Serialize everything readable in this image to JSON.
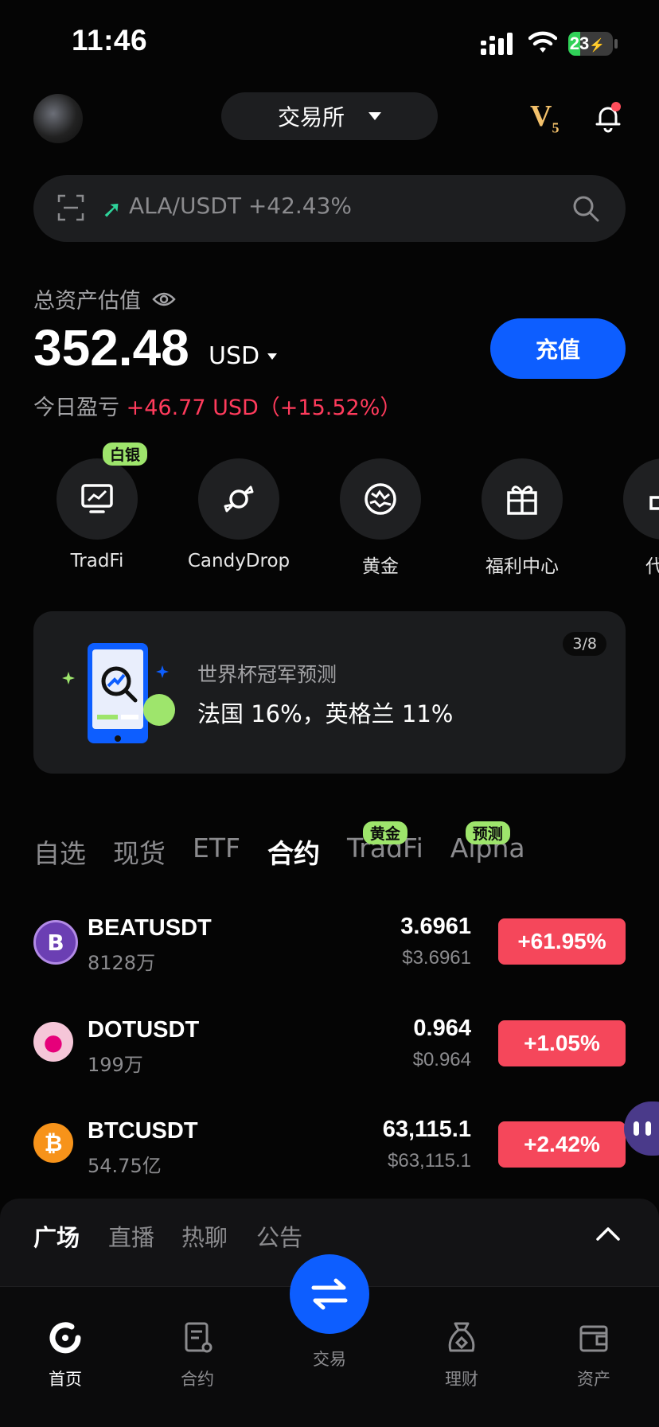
{
  "status_bar": {
    "time": "11:46",
    "battery": "23"
  },
  "header": {
    "exchange_label": "交易所",
    "vip_level": "V",
    "vip_sub": "5"
  },
  "search": {
    "text": "ALA/USDT +42.43%"
  },
  "assets": {
    "label": "总资产估值",
    "amount": "352.48",
    "unit": "USD",
    "deposit_label": "充值",
    "pnl_label": "今日盈亏",
    "pnl_value": "+46.77 USD（+15.52%）"
  },
  "quick_actions": [
    {
      "label": "TradFi",
      "badge": "白银",
      "icon": "chart-monitor-icon"
    },
    {
      "label": "CandyDrop",
      "icon": "candy-icon"
    },
    {
      "label": "黄金",
      "icon": "globe-icon"
    },
    {
      "label": "福利中心",
      "icon": "gift-icon"
    },
    {
      "label": "代理",
      "icon": "agent-icon"
    }
  ],
  "banner": {
    "pager": "3/8",
    "title": "世界杯冠军预测",
    "body": "法国 16%，英格兰 11%"
  },
  "market_tabs": [
    {
      "label": "自选"
    },
    {
      "label": "现货"
    },
    {
      "label": "ETF"
    },
    {
      "label": "合约",
      "active": true
    },
    {
      "label": "TradFi",
      "badge": "黄金"
    },
    {
      "label": "Alpha",
      "badge": "预测"
    }
  ],
  "market_rows": [
    {
      "symbol": "BEATUSDT",
      "volume": "8128万",
      "price": "3.6961",
      "price_usd": "$3.6961",
      "change": "+61.95%",
      "icon_color": "#6b3fb3",
      "icon_text": "B"
    },
    {
      "symbol": "DOTUSDT",
      "volume": "199万",
      "price": "0.964",
      "price_usd": "$0.964",
      "change": "+1.05%",
      "icon_color": "#e6007a",
      "icon_text": "●"
    },
    {
      "symbol": "BTCUSDT",
      "volume": "54.75亿",
      "price": "63,115.1",
      "price_usd": "$63,115.1",
      "change": "+2.42%",
      "icon_color": "#f7931a",
      "icon_text": "₿"
    }
  ],
  "social_tabs": [
    "广场",
    "直播",
    "热聊",
    "公告"
  ],
  "bottom_nav": [
    {
      "label": "首页",
      "active": true
    },
    {
      "label": "合约"
    },
    {
      "label": "交易"
    },
    {
      "label": "理财"
    },
    {
      "label": "资产"
    }
  ],
  "colors": {
    "accent": "#0d5eff",
    "up": "#f5475b",
    "badge": "#9ee56c",
    "vip": "#f3c16b"
  }
}
